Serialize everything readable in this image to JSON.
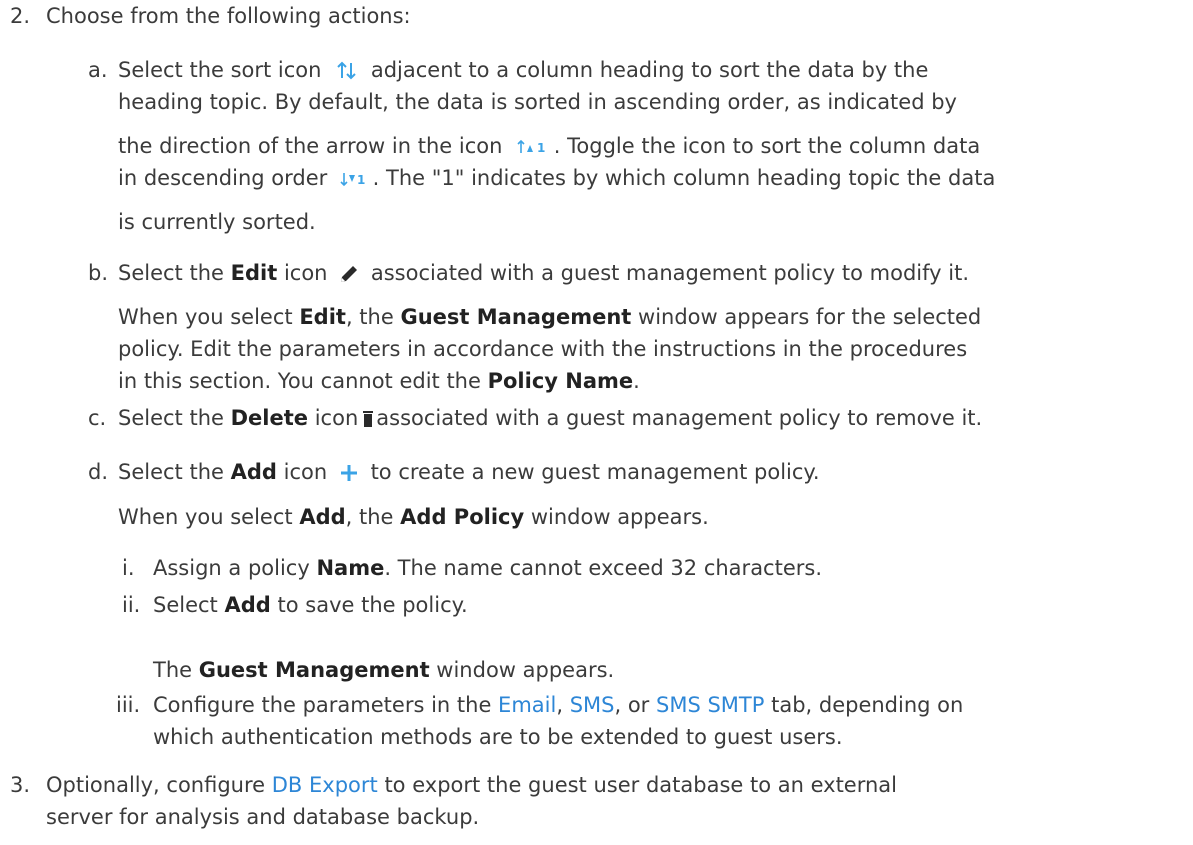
{
  "step2": {
    "number": "2.",
    "text": "Choose from the following actions:",
    "a": {
      "marker": "a.",
      "l1_pre": "Select the sort icon",
      "l1_post": "adjacent to a column heading to sort the data by the",
      "l2": "heading topic. By default, the data is sorted in ascending order, as indicated by",
      "l3_pre": "the direction of the arrow in the icon",
      "l3_post": ". Toggle the icon to sort the column data",
      "l4_pre": "in descending order",
      "l4_post": ". The \"1\" indicates by which column heading topic the data",
      "l5": "is currently sorted.",
      "sort_badge": "1"
    },
    "b": {
      "marker": "b.",
      "l1_pre": "Select the",
      "edit": "Edit",
      "l1_mid": "icon",
      "l1_post": "associated with a guest management policy to modify it.",
      "p2_pre": "When you select",
      "p2_edit": "Edit",
      "p2_mid": ", the",
      "p2_gm": "Guest Management",
      "p2_post": "window appears for the selected",
      "p2_l2": "policy. Edit the parameters in accordance with the instructions in the procedures",
      "p2_l3_pre": "in this section. You cannot edit the",
      "p2_l3_bold": "Policy Name",
      "p2_l3_post": "."
    },
    "c": {
      "marker": "c.",
      "pre": "Select the",
      "del": "Delete",
      "mid": "icon",
      "post": "associated with a guest management policy to remove it."
    },
    "d": {
      "marker": "d.",
      "pre": "Select the",
      "add": "Add",
      "mid": "icon",
      "post": "to create a new guest management policy.",
      "p2_pre": "When you select",
      "p2_add": "Add",
      "p2_mid": ", the",
      "p2_bold": "Add Policy",
      "p2_post": "window appears.",
      "i": {
        "marker": "i.",
        "pre": "Assign a policy",
        "bold": "Name",
        "post": ". The name cannot exceed 32 characters."
      },
      "ii": {
        "marker": "ii.",
        "pre": "Select",
        "bold": "Add",
        "post": "to save the policy.",
        "p2_pre": "The",
        "p2_bold": "Guest Management",
        "p2_post": "window appears."
      },
      "iii": {
        "marker": "iii.",
        "pre": "Configure the parameters in the",
        "link_email": "Email",
        "sep1": ",",
        "link_sms": "SMS",
        "sep2": ", or",
        "link_smtp": "SMS SMTP",
        "post": "tab, depending on",
        "l2": "which authentication methods are to be extended to guest users."
      }
    }
  },
  "step3": {
    "number": "3.",
    "pre": "Optionally, configure",
    "link": "DB Export",
    "post": "to export the guest user database to an external",
    "l2": "server for analysis and database backup."
  },
  "colors": {
    "text": "#3b3b3b",
    "link": "#2d86d6",
    "icon_blue": "#3ba3e6"
  }
}
